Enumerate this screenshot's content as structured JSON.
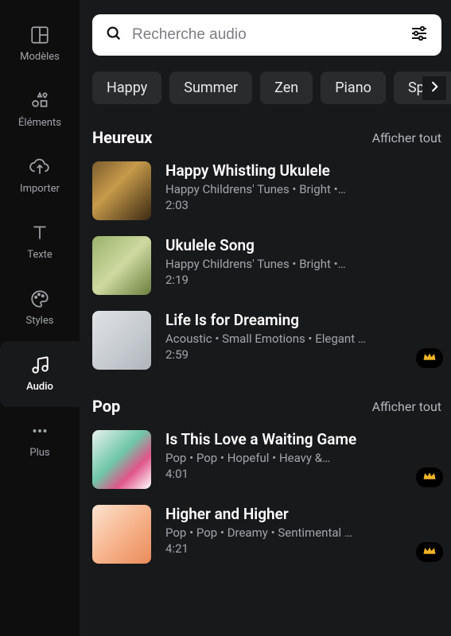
{
  "sidebar": {
    "items": [
      {
        "label": "Modèles",
        "icon": "templates-icon"
      },
      {
        "label": "Éléments",
        "icon": "elements-icon"
      },
      {
        "label": "Importer",
        "icon": "upload-icon"
      },
      {
        "label": "Texte",
        "icon": "text-icon"
      },
      {
        "label": "Styles",
        "icon": "styles-icon"
      },
      {
        "label": "Audio",
        "icon": "audio-icon",
        "active": true
      },
      {
        "label": "Plus",
        "icon": "more-icon"
      }
    ]
  },
  "search": {
    "placeholder": "Recherche audio"
  },
  "chips": [
    "Happy",
    "Summer",
    "Zen",
    "Piano",
    "Sport"
  ],
  "sections": [
    {
      "title": "Heureux",
      "view_all": "Afficher tout",
      "tracks": [
        {
          "title": "Happy Whistling Ukulele",
          "meta": "Happy Childrens' Tunes • Bright •…",
          "duration": "2:03",
          "premium": false
        },
        {
          "title": "Ukulele Song",
          "meta": "Happy Childrens' Tunes • Bright •…",
          "duration": "2:19",
          "premium": false
        },
        {
          "title": "Life Is for Dreaming",
          "meta": "Acoustic • Small Emotions • Elegant …",
          "duration": "2:59",
          "premium": true
        }
      ]
    },
    {
      "title": "Pop",
      "view_all": "Afficher tout",
      "tracks": [
        {
          "title": "Is This Love a Waiting Game",
          "meta": "Pop • Pop • Hopeful • Heavy &…",
          "duration": "4:01",
          "premium": true
        },
        {
          "title": "Higher and Higher",
          "meta": "Pop • Pop • Dreamy • Sentimental …",
          "duration": "4:21",
          "premium": true
        }
      ]
    }
  ]
}
